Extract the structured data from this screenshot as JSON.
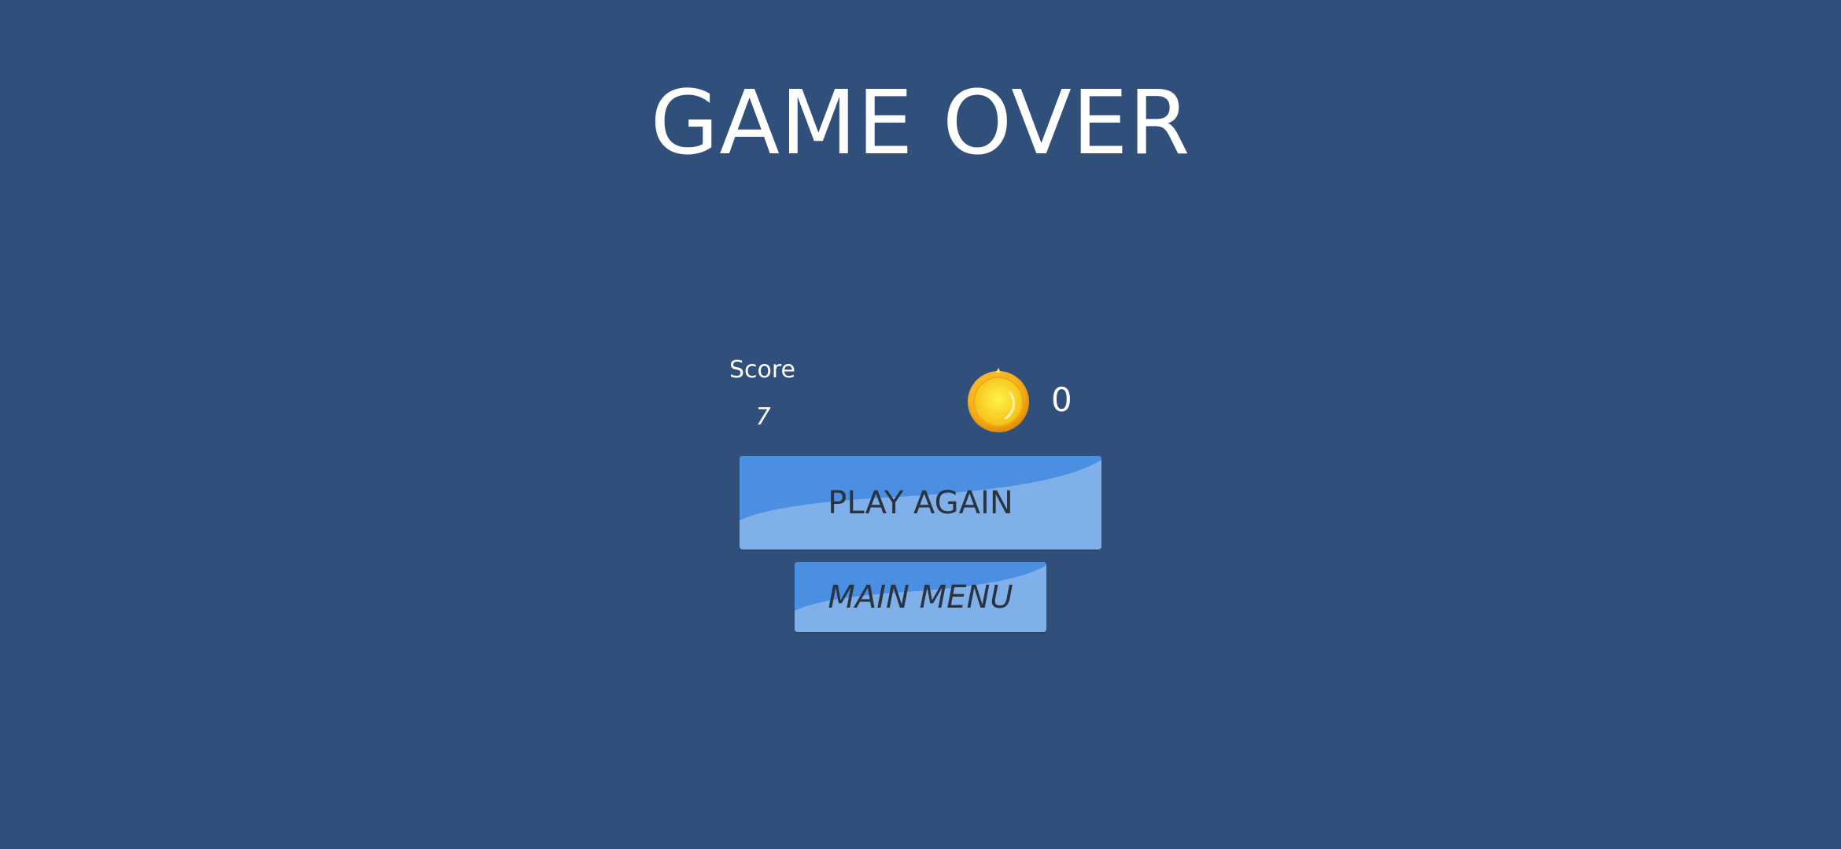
{
  "screen": {
    "title": "GAME OVER"
  },
  "stats": {
    "score_label": "Score",
    "score_value": "7",
    "coins": "0",
    "coin_icon": "gold-coin-icon"
  },
  "buttons": {
    "play_again": "PLAY AGAIN",
    "main_menu": "MAIN MENU"
  },
  "colors": {
    "background": "#314f7b",
    "button_light": "#7fb0ea",
    "button_dark": "#4a8fe2",
    "button_text": "#2a3340",
    "coin": "#f7b21c",
    "text": "#ffffff"
  }
}
